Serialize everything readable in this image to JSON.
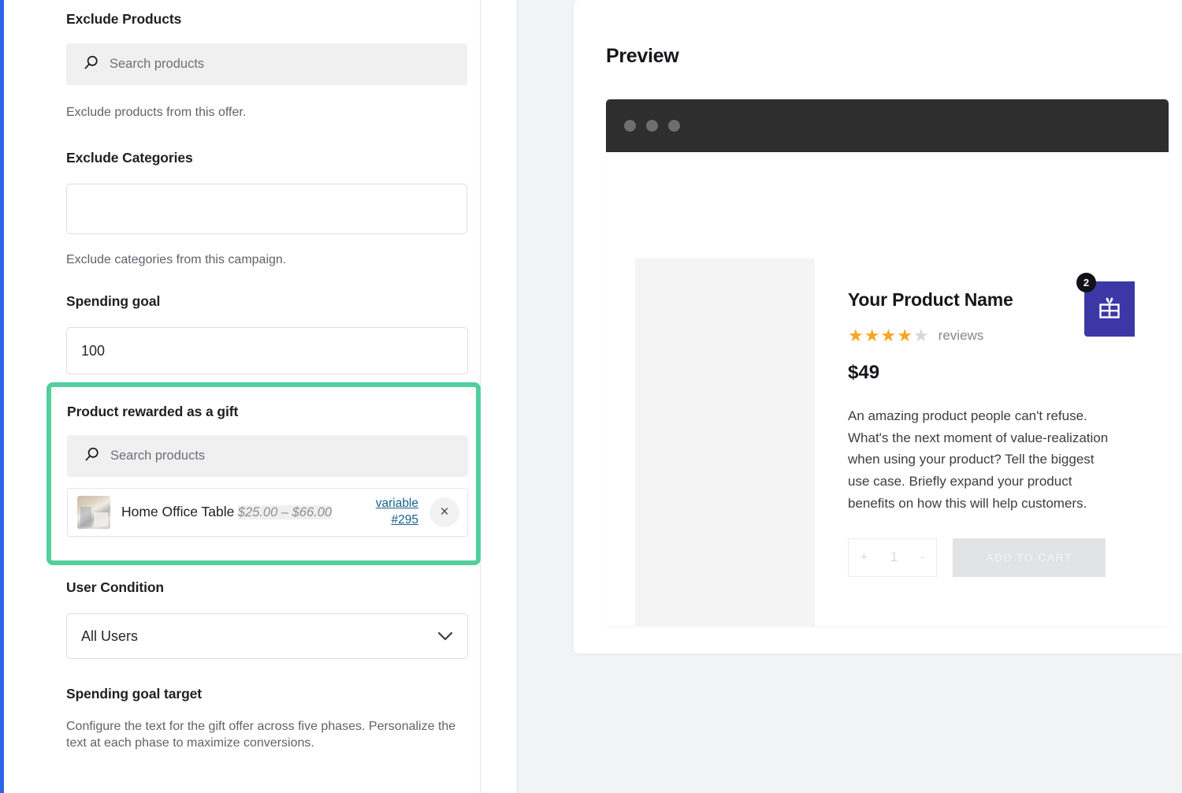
{
  "form": {
    "exclude_products": {
      "label": "Exclude Products",
      "search_placeholder": "Search products",
      "help": "Exclude products from this offer.",
      "search_icon": "search-icon"
    },
    "exclude_categories": {
      "label": "Exclude Categories",
      "value": "",
      "help": "Exclude categories from this campaign."
    },
    "spending_goal": {
      "label": "Spending goal",
      "value": "100"
    },
    "gift_product": {
      "label": "Product rewarded as a gift",
      "search_placeholder": "Search products",
      "search_icon": "search-icon",
      "highlight_color": "#52cf9e",
      "selected": {
        "name": "Home Office Table",
        "price": "$25.00 – $66.00",
        "type_link": "variable",
        "id_link": "#295",
        "remove_icon": "×"
      }
    },
    "user_condition": {
      "label": "User Condition",
      "value": "All Users",
      "chevron_icon": "chevron-down-icon"
    },
    "spending_goal_target": {
      "label": "Spending goal target",
      "help": "Configure the text for the gift offer across five phases. Personalize the text at each phase to maximize conversions."
    }
  },
  "preview": {
    "title": "Preview",
    "browser": {
      "dots": 3,
      "bar_color": "#2e2e2e"
    },
    "product": {
      "name": "Your Product Name",
      "rating_filled": 4,
      "rating_total": 5,
      "reviews_label": "reviews",
      "price": "$49",
      "description": "An amazing product people can't refuse. What's the next moment of value-realization when using your product? Tell the biggest use case. Briefly expand your product benefits on how this will help customers.",
      "quantity_increase": "+",
      "quantity_value": "1",
      "quantity_decrease": "-",
      "add_to_cart_label": "ADD TO CART",
      "star_color": "#f5a623"
    },
    "gift_widget": {
      "icon": "gift-icon",
      "count": "2",
      "color": "#3b38a6"
    }
  }
}
